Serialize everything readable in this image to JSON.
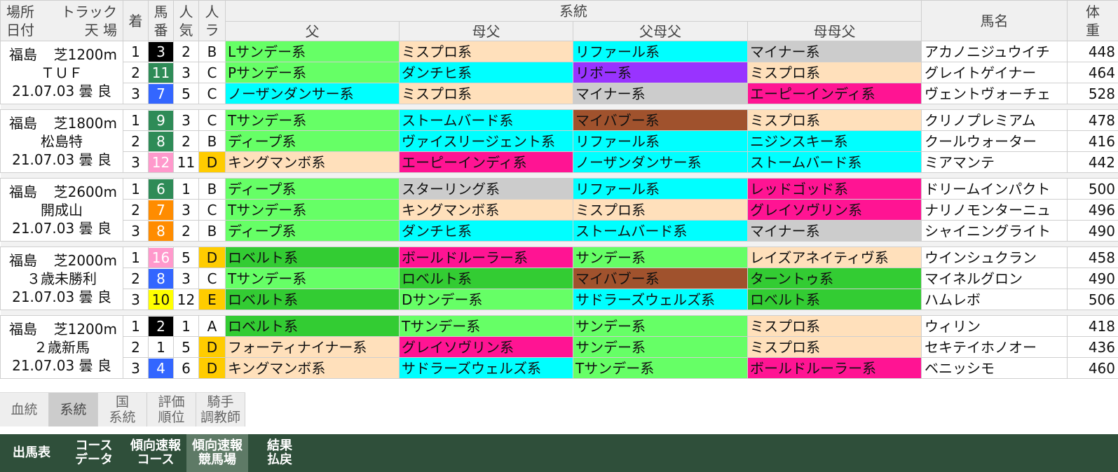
{
  "header": {
    "place": "場所",
    "track": "トラック",
    "date": "日付",
    "weather": "天 場",
    "rank": "着",
    "num": "馬\n番",
    "pop": "人\n気",
    "rate": "人\nラ",
    "lineage": "系統",
    "sire": "父",
    "damsire": "母父",
    "sire_damsire": "父母父",
    "dam_damsire": "母母父",
    "horse": "馬名",
    "weight": "体\n重"
  },
  "colors": {
    "sunday": "#66ff66",
    "misupuro": "#ffe0bb",
    "cyan": "#00ffff",
    "minor": "#cccccc",
    "ribot": "#9933ff",
    "pink": "#ff1493",
    "brown": "#a0522d",
    "robert": "#33cc33"
  },
  "races": [
    {
      "place": "福島",
      "track": "芝1200m",
      "name": "ＴＵＦ",
      "date": "21.07.03",
      "weather": "曇",
      "cond": "良",
      "rows": [
        {
          "rank": "1",
          "num": "3",
          "nc": "n-black",
          "pop": "2",
          "rate": "B",
          "rc": "",
          "sire": "Lサンデー系",
          "s1": "c-sun",
          "dam": "ミスプロ系",
          "s2": "c-mis",
          "sdam": "リファール系",
          "s3": "c-cyan",
          "ddam": "マイナー系",
          "s4": "c-gray",
          "horse": "アカノニジュウイチ",
          "weight": "448"
        },
        {
          "rank": "2",
          "num": "11",
          "nc": "n-green",
          "pop": "3",
          "rate": "C",
          "rc": "",
          "sire": "Pサンデー系",
          "s1": "c-sun",
          "dam": "ダンチヒ系",
          "s2": "c-cyan",
          "sdam": "リボー系",
          "s3": "c-purple",
          "ddam": "ミスプロ系",
          "s4": "c-mis",
          "horse": "グレイトゲイナー",
          "weight": "464"
        },
        {
          "rank": "3",
          "num": "7",
          "nc": "n-blue",
          "pop": "5",
          "rate": "C",
          "rc": "",
          "sire": "ノーザンダンサー系",
          "s1": "c-cyan",
          "dam": "ミスプロ系",
          "s2": "c-mis",
          "sdam": "マイナー系",
          "s3": "c-gray",
          "ddam": "エーピーインディ系",
          "s4": "c-pink",
          "horse": "ヴェントヴォーチェ",
          "weight": "528"
        }
      ]
    },
    {
      "place": "福島",
      "track": "芝1800m",
      "name": "松島特",
      "date": "21.07.03",
      "weather": "曇",
      "cond": "良",
      "rows": [
        {
          "rank": "1",
          "num": "9",
          "nc": "n-green",
          "pop": "3",
          "rate": "C",
          "rc": "",
          "sire": "Tサンデー系",
          "s1": "c-sun",
          "dam": "ストームバード系",
          "s2": "c-cyan",
          "sdam": "マイバブー系",
          "s3": "c-brown",
          "ddam": "ミスプロ系",
          "s4": "c-mis",
          "horse": "クリノプレミアム",
          "weight": "478"
        },
        {
          "rank": "2",
          "num": "8",
          "nc": "n-green",
          "pop": "2",
          "rate": "B",
          "rc": "",
          "sire": "ディープ系",
          "s1": "c-sun",
          "dam": "ヴァイスリージェント系",
          "s2": "c-cyan",
          "sdam": "リファール系",
          "s3": "c-cyan",
          "ddam": "ニジンスキー系",
          "s4": "c-cyan",
          "horse": "クールウォーター",
          "weight": "416"
        },
        {
          "rank": "3",
          "num": "12",
          "nc": "n-pink",
          "pop": "11",
          "rate": "D",
          "rc": "r-yellow",
          "sire": "キングマンボ系",
          "s1": "c-mis",
          "dam": "エーピーインディ系",
          "s2": "c-pink",
          "sdam": "ノーザンダンサー系",
          "s3": "c-cyan",
          "ddam": "ストームバード系",
          "s4": "c-cyan",
          "horse": "ミアマンテ",
          "weight": "442"
        }
      ]
    },
    {
      "place": "福島",
      "track": "芝2600m",
      "name": "開成山",
      "date": "21.07.03",
      "weather": "曇",
      "cond": "良",
      "rows": [
        {
          "rank": "1",
          "num": "6",
          "nc": "n-green",
          "pop": "1",
          "rate": "B",
          "rc": "",
          "sire": "ディープ系",
          "s1": "c-sun",
          "dam": "スターリング系",
          "s2": "c-gray",
          "sdam": "リファール系",
          "s3": "c-cyan",
          "ddam": "レッドゴッド系",
          "s4": "c-pink",
          "horse": "ドリームインパクト",
          "weight": "500"
        },
        {
          "rank": "2",
          "num": "7",
          "nc": "n-orange",
          "pop": "3",
          "rate": "C",
          "rc": "",
          "sire": "Tサンデー系",
          "s1": "c-sun",
          "dam": "キングマンボ系",
          "s2": "c-mis",
          "sdam": "ミスプロ系",
          "s3": "c-mis",
          "ddam": "グレイソヴリン系",
          "s4": "c-pink",
          "horse": "ナリノモンターニュ",
          "weight": "496"
        },
        {
          "rank": "3",
          "num": "8",
          "nc": "n-orange",
          "pop": "2",
          "rate": "B",
          "rc": "",
          "sire": "ディープ系",
          "s1": "c-sun",
          "dam": "ダンチヒ系",
          "s2": "c-cyan",
          "sdam": "ストームバード系",
          "s3": "c-cyan",
          "ddam": "マイナー系",
          "s4": "c-gray",
          "horse": "シャイニングライト",
          "weight": "490"
        }
      ]
    },
    {
      "place": "福島",
      "track": "芝2000m",
      "name": "３歳未勝利",
      "date": "21.07.03",
      "weather": "曇",
      "cond": "良",
      "rows": [
        {
          "rank": "1",
          "num": "16",
          "nc": "n-pink",
          "pop": "5",
          "rate": "D",
          "rc": "r-yellow",
          "sire": "ロベルト系",
          "s1": "c-green",
          "dam": "ボールドルーラー系",
          "s2": "c-pink",
          "sdam": "サンデー系",
          "s3": "c-sun",
          "ddam": "レイズアネイティヴ系",
          "s4": "c-mis",
          "horse": "ウインシュクラン",
          "weight": "458"
        },
        {
          "rank": "2",
          "num": "8",
          "nc": "n-blue",
          "pop": "3",
          "rate": "C",
          "rc": "",
          "sire": "Tサンデー系",
          "s1": "c-sun",
          "dam": "ロベルト系",
          "s2": "c-green",
          "sdam": "マイバブー系",
          "s3": "c-brown",
          "ddam": "ターントゥ系",
          "s4": "c-green",
          "horse": "マイネルグロン",
          "weight": "490"
        },
        {
          "rank": "3",
          "num": "10",
          "nc": "n-yellow",
          "pop": "12",
          "rate": "E",
          "rc": "r-yellow",
          "sire": "ロベルト系",
          "s1": "c-green",
          "dam": "Dサンデー系",
          "s2": "c-sun",
          "sdam": "サドラーズウェルズ系",
          "s3": "c-cyan",
          "ddam": "ロベルト系",
          "s4": "c-green",
          "horse": "ハムレボ",
          "weight": "506"
        }
      ]
    },
    {
      "place": "福島",
      "track": "芝1200m",
      "name": "２歳新馬",
      "date": "21.07.03",
      "weather": "曇",
      "cond": "良",
      "rows": [
        {
          "rank": "1",
          "num": "2",
          "nc": "n-black",
          "pop": "1",
          "rate": "A",
          "rc": "",
          "sire": "ロベルト系",
          "s1": "c-green",
          "dam": "Tサンデー系",
          "s2": "c-sun",
          "sdam": "サンデー系",
          "s3": "c-sun",
          "ddam": "ミスプロ系",
          "s4": "c-mis",
          "horse": "ウィリン",
          "weight": "418"
        },
        {
          "rank": "2",
          "num": "1",
          "nc": "n-white",
          "pop": "5",
          "rate": "D",
          "rc": "r-yellow",
          "sire": "フォーティナイナー系",
          "s1": "c-mis",
          "dam": "グレイソヴリン系",
          "s2": "c-pink",
          "sdam": "サンデー系",
          "s3": "c-sun",
          "ddam": "ミスプロ系",
          "s4": "c-mis",
          "horse": "セキテイホノオー",
          "weight": "436"
        },
        {
          "rank": "3",
          "num": "4",
          "nc": "n-blue",
          "pop": "6",
          "rate": "D",
          "rc": "r-yellow",
          "sire": "キングマンボ系",
          "s1": "c-mis",
          "dam": "サドラーズウェルズ系",
          "s2": "c-cyan",
          "sdam": "Tサンデー系",
          "s3": "c-sun",
          "ddam": "ボールドルーラー系",
          "s4": "c-pink",
          "horse": "ベニッシモ",
          "weight": "460"
        }
      ]
    }
  ],
  "subtabs": [
    {
      "label": "血統",
      "active": false
    },
    {
      "label": "系統",
      "active": true
    },
    {
      "label": "国\n系統",
      "active": false
    },
    {
      "label": "評価\n順位",
      "active": false
    },
    {
      "label": "騎手\n調教師",
      "active": false
    }
  ],
  "navtabs": [
    {
      "label": "出馬表",
      "active": false
    },
    {
      "label": "コース\nデータ",
      "active": false
    },
    {
      "label": "傾向速報\nコース",
      "active": false
    },
    {
      "label": "傾向速報\n競馬場",
      "active": true
    },
    {
      "label": "結果\n払戻",
      "active": false
    }
  ]
}
